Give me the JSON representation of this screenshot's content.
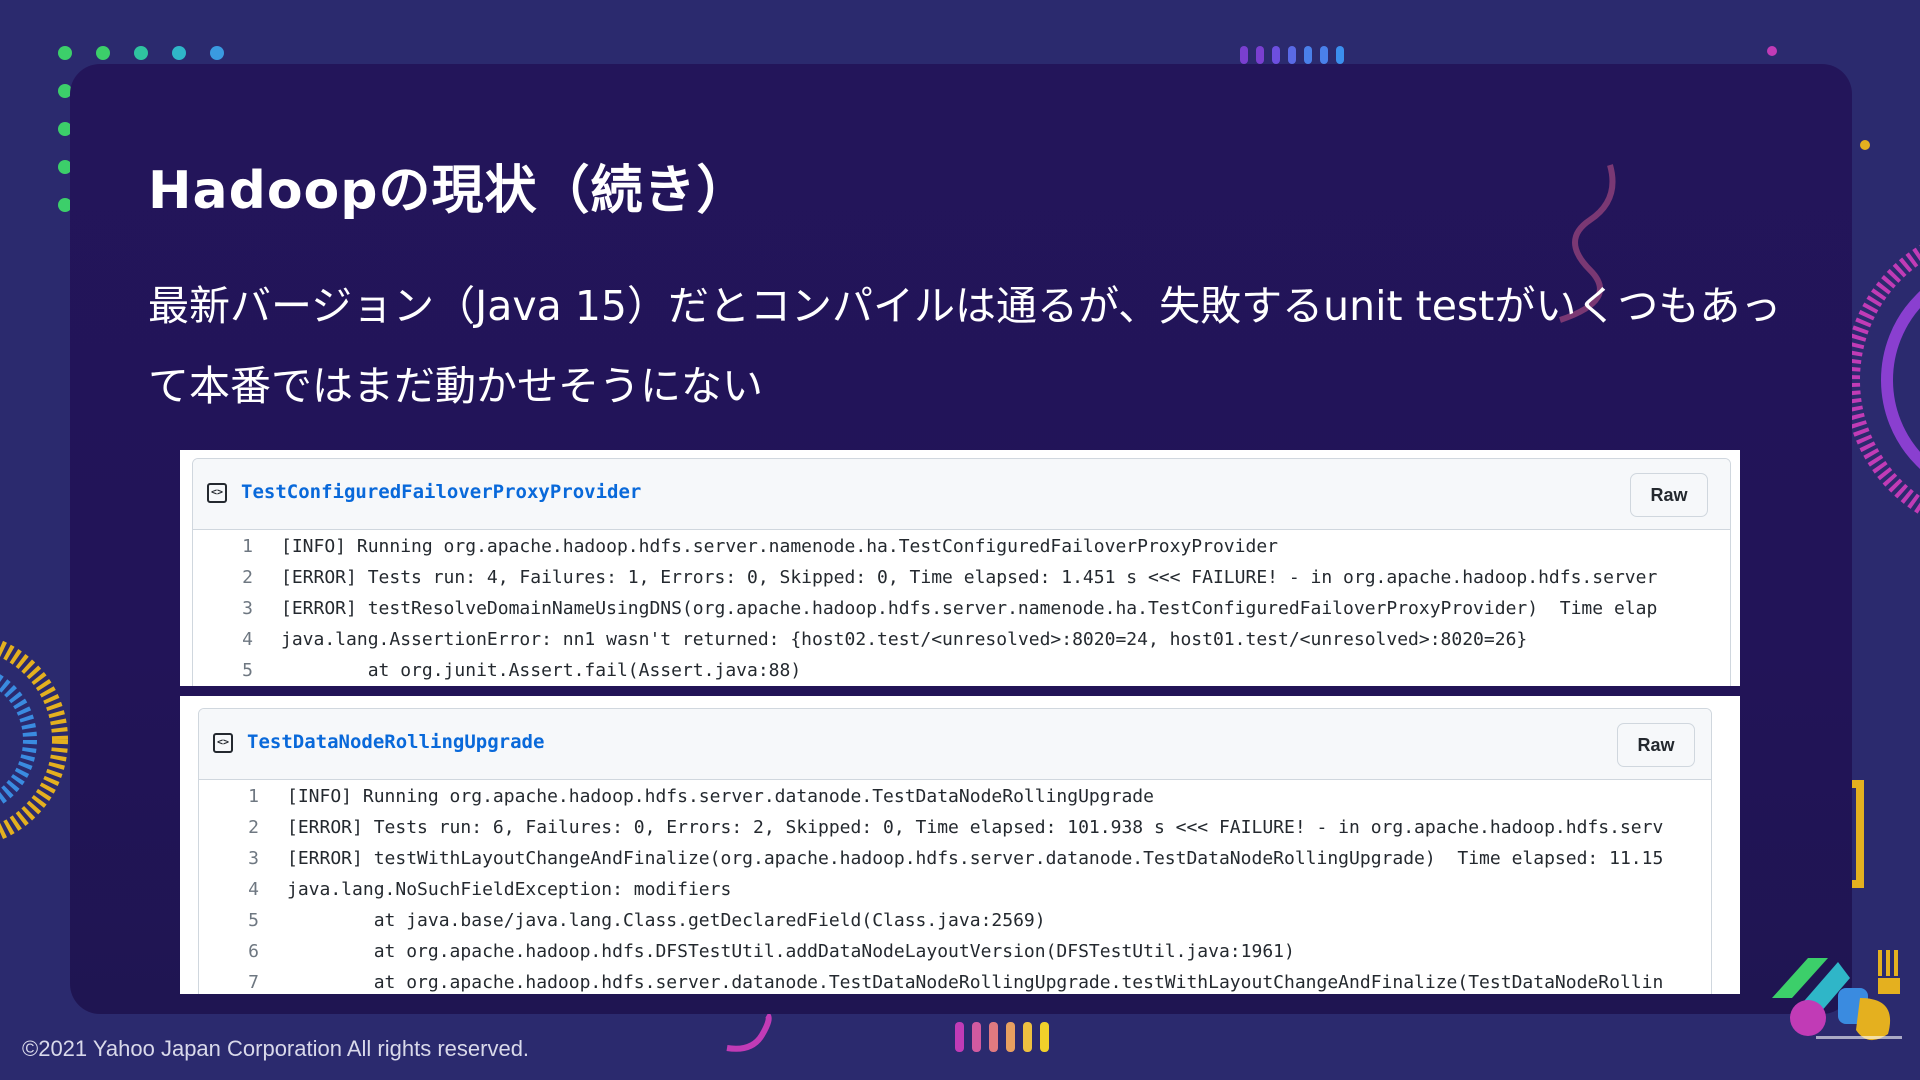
{
  "slide": {
    "title": "Hadoopの現状（続き）",
    "subtitle": "最新バージョン（Java 15）だとコンパイルは通るが、失敗するunit testがいくつもあって本番ではまだ動かせそうにない",
    "copyright": "©2021 Yahoo Japan Corporation All rights reserved.",
    "logo": "yahoo-japan-tech-conference-2021-logo"
  },
  "colors": {
    "background": "#2b2a6e",
    "card": "#23155a",
    "link": "#0969da"
  },
  "gists": [
    {
      "icon": "code-square-icon",
      "file_name": "TestConfiguredFailoverProxyProvider",
      "raw_label": "Raw",
      "lines": [
        {
          "num": "1",
          "text": "[INFO] Running org.apache.hadoop.hdfs.server.namenode.ha.TestConfiguredFailoverProxyProvider"
        },
        {
          "num": "2",
          "text": "[ERROR] Tests run: 4, Failures: 1, Errors: 0, Skipped: 0, Time elapsed: 1.451 s <<< FAILURE! - in org.apache.hadoop.hdfs.server"
        },
        {
          "num": "3",
          "text": "[ERROR] testResolveDomainNameUsingDNS(org.apache.hadoop.hdfs.server.namenode.ha.TestConfiguredFailoverProxyProvider)  Time elap"
        },
        {
          "num": "4",
          "text": "java.lang.AssertionError: nn1 wasn't returned: {host02.test/<unresolved>:8020=24, host01.test/<unresolved>:8020=26}"
        },
        {
          "num": "5",
          "text": "        at org.junit.Assert.fail(Assert.java:88)"
        }
      ]
    },
    {
      "icon": "code-square-icon",
      "file_name": "TestDataNodeRollingUpgrade",
      "raw_label": "Raw",
      "lines": [
        {
          "num": "1",
          "text": "[INFO] Running org.apache.hadoop.hdfs.server.datanode.TestDataNodeRollingUpgrade"
        },
        {
          "num": "2",
          "text": "[ERROR] Tests run: 6, Failures: 0, Errors: 2, Skipped: 0, Time elapsed: 101.938 s <<< FAILURE! - in org.apache.hadoop.hdfs.serv"
        },
        {
          "num": "3",
          "text": "[ERROR] testWithLayoutChangeAndFinalize(org.apache.hadoop.hdfs.server.datanode.TestDataNodeRollingUpgrade)  Time elapsed: 11.15"
        },
        {
          "num": "4",
          "text": "java.lang.NoSuchFieldException: modifiers"
        },
        {
          "num": "5",
          "text": "        at java.base/java.lang.Class.getDeclaredField(Class.java:2569)"
        },
        {
          "num": "6",
          "text": "        at org.apache.hadoop.hdfs.DFSTestUtil.addDataNodeLayoutVersion(DFSTestUtil.java:1961)"
        },
        {
          "num": "7",
          "text": "        at org.apache.hadoop.hdfs.server.datanode.TestDataNodeRollingUpgrade.testWithLayoutChangeAndFinalize(TestDataNodeRollin"
        }
      ]
    }
  ]
}
